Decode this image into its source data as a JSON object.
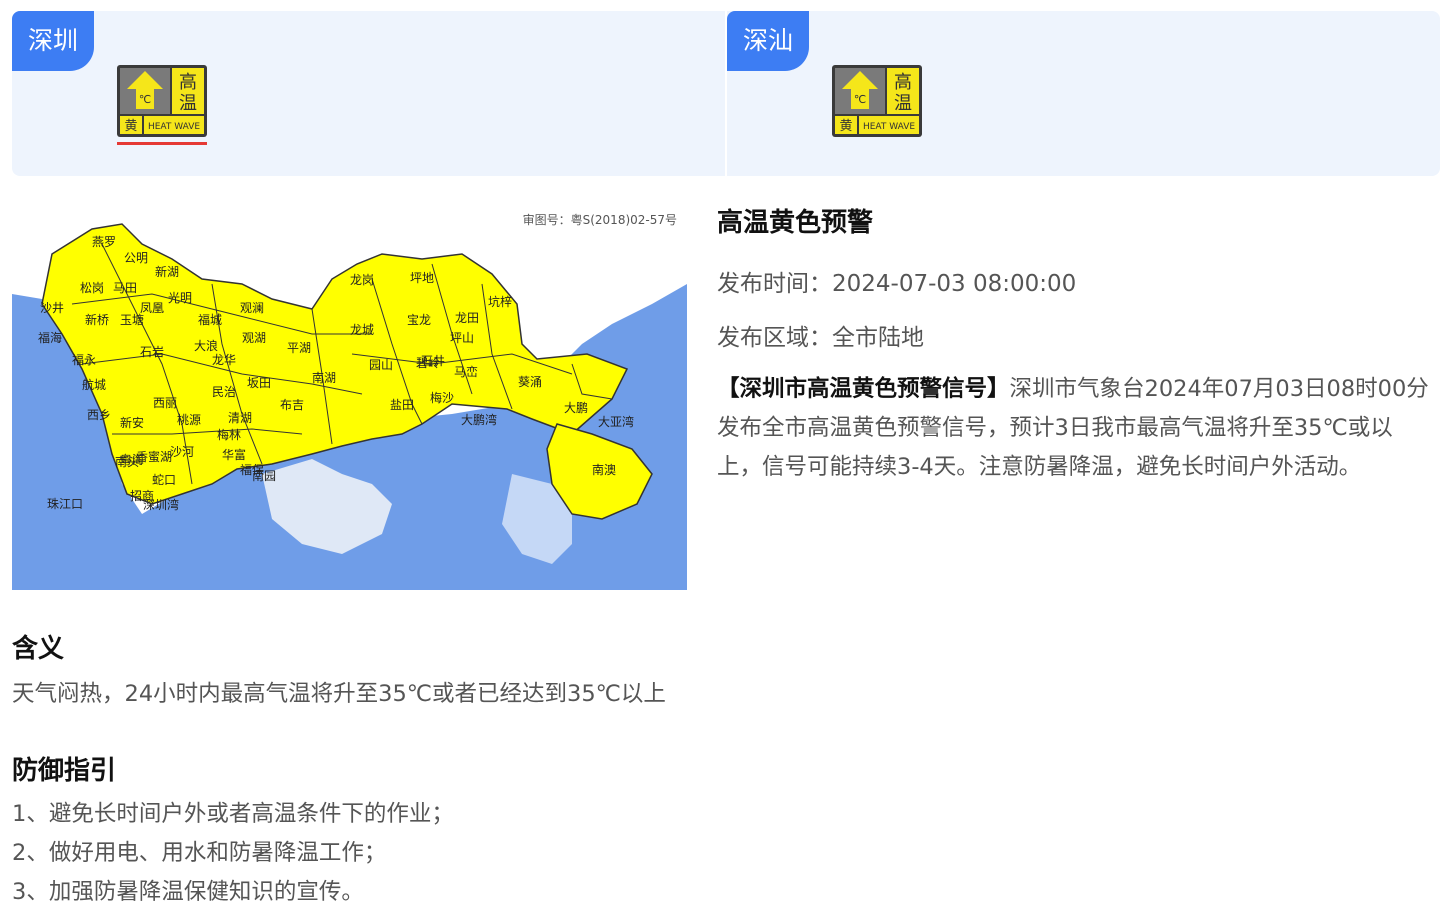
{
  "regions": [
    {
      "name": "深圳",
      "selected": true
    },
    {
      "name": "深汕",
      "selected": false
    }
  ],
  "signal": {
    "chars": [
      "高",
      "温"
    ],
    "unit": "℃",
    "level": "黄",
    "english": "HEAT WAVE",
    "icon": "heat-wave-yellow-icon",
    "colors": {
      "yellow": "#f5e61a",
      "grey": "#7a7a7a",
      "dark": "#3a3a3a"
    }
  },
  "map": {
    "approval_no": "审图号：粤S(2018)02-57号",
    "labels": [
      "燕罗",
      "公明",
      "新湖",
      "松岗",
      "马田",
      "光明",
      "沙井",
      "凤凰",
      "新桥",
      "玉塘",
      "福城",
      "观澜",
      "福海",
      "石岩",
      "大浪",
      "观湖",
      "平湖",
      "福永",
      "龙华",
      "民治",
      "坂田",
      "南湖",
      "布吉",
      "清湖",
      "航城",
      "西乡",
      "新安",
      "西丽",
      "桃源",
      "梅林",
      "南头",
      "粤海",
      "沙河",
      "香蜜湖",
      "华富",
      "福保",
      "南园",
      "招商",
      "蛇口",
      "龙岗",
      "坪地",
      "龙城",
      "宝龙",
      "坑梓",
      "龙田",
      "坪山",
      "碧岭",
      "石井",
      "园山",
      "马峦",
      "葵涌",
      "盐田",
      "大鹏",
      "梅沙",
      "南澳",
      "大鹏湾",
      "大亚湾",
      "珠江口",
      "深圳湾"
    ],
    "colors": {
      "sea": "#6f9de8",
      "land": "#ffff00",
      "border": "#333333",
      "sea_light": "#dfe8f6"
    }
  },
  "detail": {
    "title": "高温黄色预警",
    "time_label": "发布时间：",
    "time_value": "2024-07-03 08:00:00",
    "area_label": "发布区域：",
    "area_value": "全市陆地",
    "content_head": "【深圳市高温黄色预警信号】",
    "content_body": "深圳市气象台2024年07月03日08时00分发布全市高温黄色预警信号，预计3日我市最高气温将升至35℃或以上，信号可能持续3-4天。注意防暑降温，避免长时间户外活动。"
  },
  "meaning": {
    "title": "含义",
    "text": "天气闷热，24小时内最高气温将升至35℃或者已经达到35℃以上"
  },
  "guide": {
    "title": "防御指引",
    "items": [
      "1、避免长时间户外或者高温条件下的作业；",
      "2、做好用电、用水和防暑降温工作；",
      "3、加强防暑降温保健知识的宣传。"
    ]
  }
}
